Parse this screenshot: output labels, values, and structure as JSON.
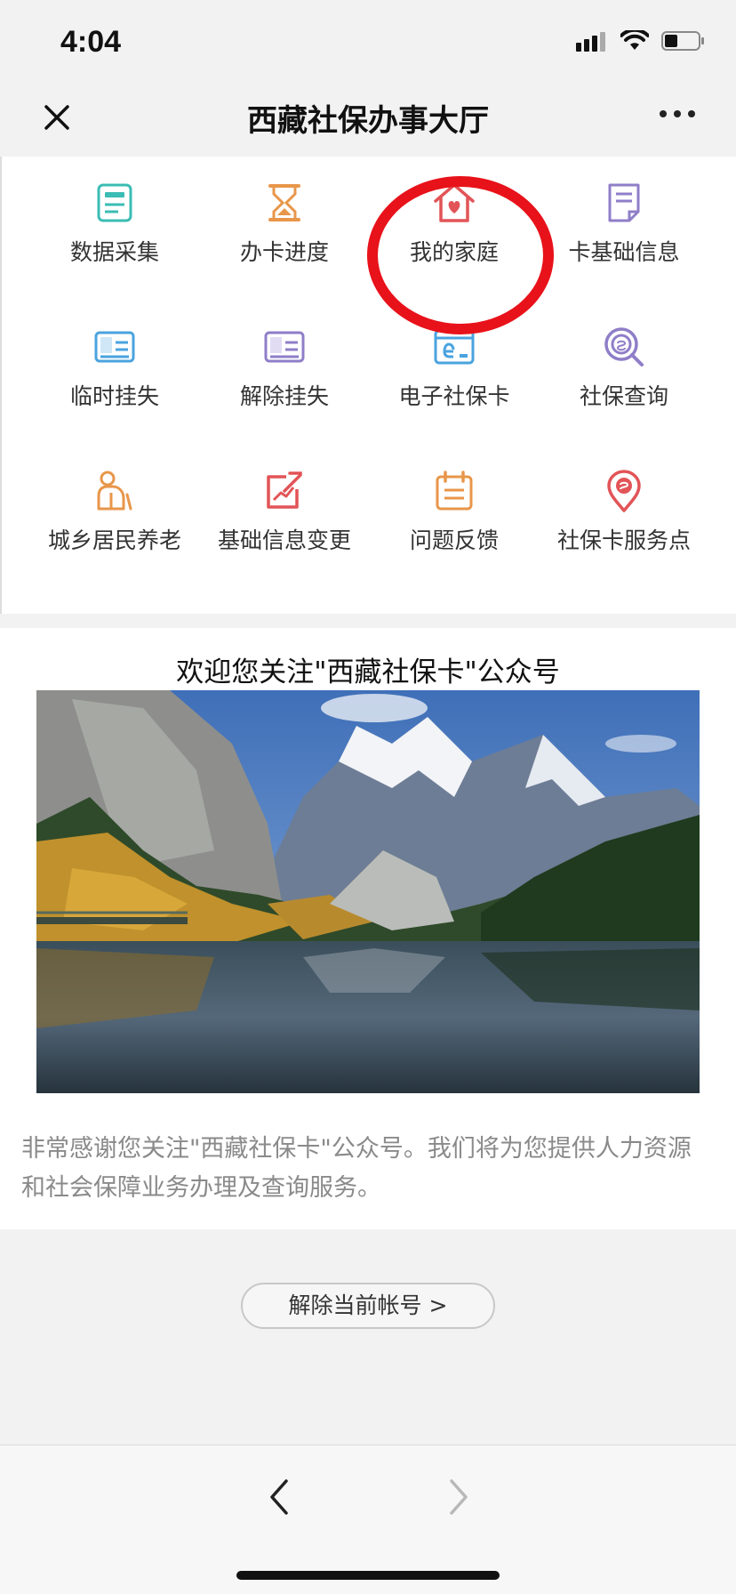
{
  "status_bar": {
    "time": "4:04"
  },
  "nav": {
    "title": "西藏社保办事大厅"
  },
  "grid": {
    "items": [
      {
        "label": "数据采集",
        "icon": "data-collection-icon",
        "color": "#3bbcb4"
      },
      {
        "label": "办卡进度",
        "icon": "hourglass-icon",
        "color": "#e8964a"
      },
      {
        "label": "我的家庭",
        "icon": "family-house-icon",
        "color": "#e25457"
      },
      {
        "label": "卡基础信息",
        "icon": "document-icon",
        "color": "#8f7ec8"
      },
      {
        "label": "临时挂失",
        "icon": "temp-report-loss-icon",
        "color": "#4aa3df"
      },
      {
        "label": "解除挂失",
        "icon": "cancel-report-loss-icon",
        "color": "#8f7ec8"
      },
      {
        "label": "电子社保卡",
        "icon": "e-card-icon",
        "color": "#4aa3df"
      },
      {
        "label": "社保查询",
        "icon": "search-si-icon",
        "color": "#8f7ec8"
      },
      {
        "label": "城乡居民养老",
        "icon": "elderly-icon",
        "color": "#e8964a"
      },
      {
        "label": "基础信息变更",
        "icon": "edit-chart-icon",
        "color": "#e25457"
      },
      {
        "label": "问题反馈",
        "icon": "feedback-clipboard-icon",
        "color": "#e8964a"
      },
      {
        "label": "社保卡服务点",
        "icon": "location-pin-icon",
        "color": "#e25457"
      }
    ]
  },
  "article": {
    "title": "欢迎您关注\"西藏社保卡\"公众号",
    "body": "非常感谢您关注\"西藏社保卡\"公众号。我们将为您提供人力资源和社会保障业务办理及查询服务。"
  },
  "unbind_button": {
    "label": "解除当前帐号 >"
  }
}
